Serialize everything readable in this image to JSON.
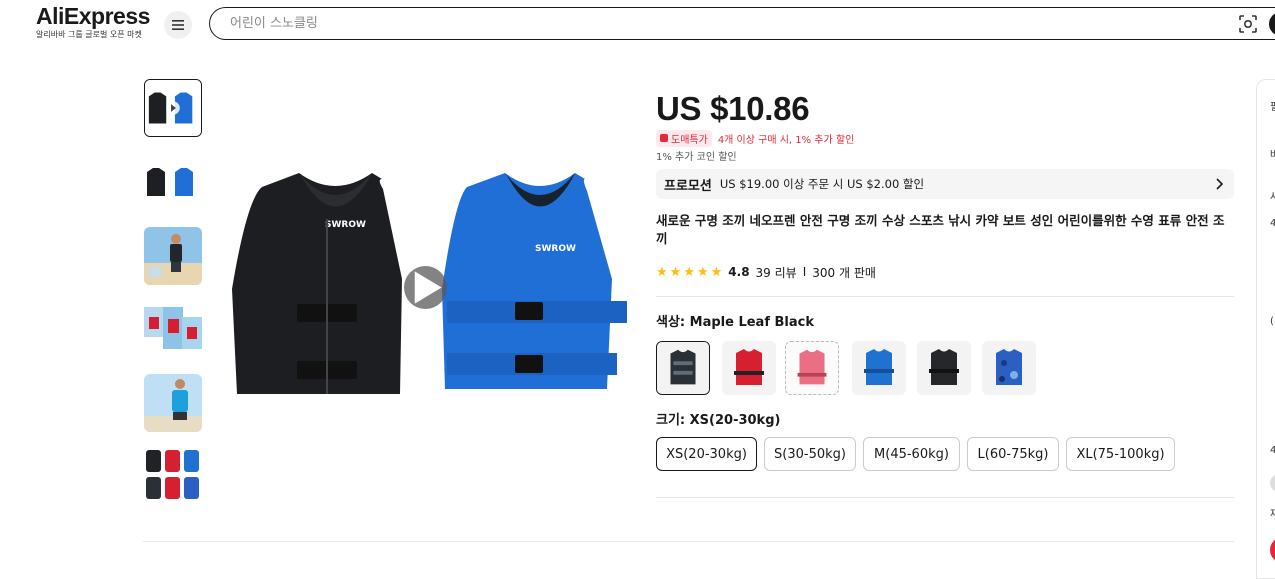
{
  "header": {
    "brand": "AliExpress",
    "tagline": "알리바바 그룹 글로벌 오픈 마켓",
    "search_placeholder": "어린이 스노클링"
  },
  "gallery": {
    "thumbnails": [
      {
        "label": "black-blue-vests-video",
        "active": true
      },
      {
        "label": "black-blue-vests"
      },
      {
        "label": "man-wearing-vest-beach"
      },
      {
        "label": "women-wearing-red-vests"
      },
      {
        "label": "man-wearing-blue-vest"
      },
      {
        "label": "color-variants-grid"
      }
    ],
    "main_image_text": {
      "vest_brand": "SWROW"
    }
  },
  "product": {
    "price": "US $10.86",
    "wholesale_badge": "도매특가",
    "wholesale_text": "4개 이상 구매 시, 1% 추가 할인",
    "coin_text": "1% 추가 코인 할인",
    "promo_label": "프로모션",
    "promo_text": "US $19.00 이상 주문 시 US $2.00 할인",
    "title": "새로운 구명 조끼 네오프렌 안전 구명 조끼 수상 스포츠 낚시 카약 보트 성인 어린이를위한 수영 표류 안전 조끼",
    "rating": "4.8",
    "review_count": "39 리뷰",
    "separator": "I",
    "sold_count": "300 개 판매",
    "color_label": "색상: Maple Leaf Black",
    "color_swatches": [
      {
        "name": "Maple Leaf Black",
        "color": "#2b2f36",
        "active": true
      },
      {
        "name": "Red",
        "color": "#d61f30"
      },
      {
        "name": "Pink",
        "color": "#ea6f84"
      },
      {
        "name": "Blue",
        "color": "#1f72d2"
      },
      {
        "name": "Black",
        "color": "#25272b"
      },
      {
        "name": "Blue Camo",
        "color": "#2a5fc4"
      }
    ],
    "size_label": "크기: XS(20-30kg)",
    "sizes": [
      "XS(20-30kg)",
      "S(30-50kg)",
      "M(45-60kg)",
      "L(60-75kg)",
      "XL(75-100kg)"
    ],
    "selected_size": "XS(20-30kg)"
  },
  "right_panel": {
    "partial_chars": [
      "필",
      "바",
      "사",
      "4",
      "(",
      "4",
      "재"
    ]
  },
  "colors": {
    "accent_red": "#e4283a",
    "star": "#fdbe10",
    "text": "#191919"
  }
}
